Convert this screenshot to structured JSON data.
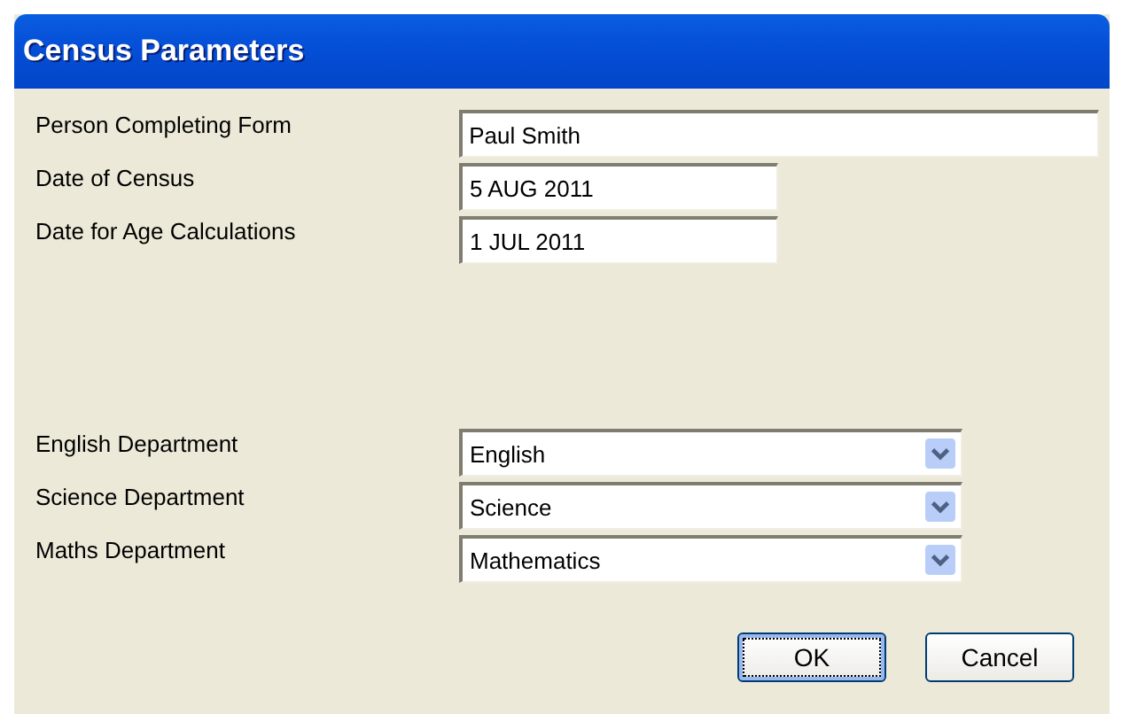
{
  "window": {
    "title": "Census Parameters"
  },
  "fields": [
    {
      "label": "Person Completing Form",
      "value": "Paul Smith",
      "kind": "text"
    },
    {
      "label": "Date of Census",
      "value": "5 AUG 2011",
      "kind": "date"
    },
    {
      "label": "Date for Age Calculations",
      "value": "1 JUL 2011",
      "kind": "date"
    }
  ],
  "departments": [
    {
      "label": "English Department",
      "value": "English",
      "kind": "combo"
    },
    {
      "label": "Science Department",
      "value": "Science",
      "kind": "combo"
    },
    {
      "label": "Maths Department",
      "value": "Mathematics",
      "kind": "combo"
    }
  ],
  "buttons": [
    {
      "label": "OK",
      "default": true
    },
    {
      "label": "Cancel",
      "default": false
    }
  ]
}
